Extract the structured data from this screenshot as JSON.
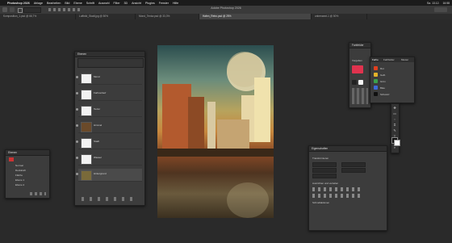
{
  "menubar": {
    "apple": "",
    "items": [
      "Photoshop 2026",
      "Ablage",
      "Bearbeiten",
      "Bild",
      "Ebene",
      "Schrift",
      "Auswahl",
      "Filter",
      "3D",
      "Ansicht",
      "Plugins",
      "Fenster",
      "Hilfe"
    ],
    "right": [
      "Sa. 13.12.",
      "16:58"
    ]
  },
  "window": {
    "title": "Adobe Photoshop 2026"
  },
  "tabs": [
    "Komposition_1.psd @ 66,7%",
    "Luftbild_Stadt.jpg @ 50%",
    "Mond_Textur.psd @ 33,3%",
    "Hafen_Retro.psd @ 25%",
    "unbenannt-1 @ 50%"
  ],
  "layers_panel": {
    "title": "Ebenen",
    "layers": [
      {
        "name": "Mond"
      },
      {
        "name": "Farbverlauf"
      },
      {
        "name": "Textur"
      },
      {
        "name": "Himmel"
      },
      {
        "name": "Stadt"
      },
      {
        "name": "Wasser"
      },
      {
        "name": "Hintergrund"
      }
    ]
  },
  "small_panel": {
    "title": "Ebenen",
    "items": [
      "Normal",
      "Deckkraft",
      "Fläche",
      "Ebene 1",
      "Ebene 2"
    ]
  },
  "swatches_panel": {
    "title": "Farbfelder",
    "label": "Vorgaben",
    "colors": [
      "#e0334e",
      "#222222",
      "#f7f7f7"
    ]
  },
  "properties_panel": {
    "tabs": [
      "Farbe",
      "Farbfelder",
      "Muster"
    ],
    "rows": [
      "Rot",
      "Gelb",
      "Grün",
      "Blau",
      "Schwarz"
    ],
    "colors": [
      "#e2401f",
      "#e3b32a",
      "#3aa04b",
      "#3d6ad6",
      "#111111"
    ]
  },
  "adjust_panel": {
    "title": "Eigenschaften",
    "label1": "Transformieren",
    "label2": "Ausrichten und verteilen",
    "label3": "Schnellaktionen"
  },
  "colors": {
    "workspace": "#2a2a2a",
    "panel": "#3c3c3c",
    "accent": "#e0334e"
  }
}
